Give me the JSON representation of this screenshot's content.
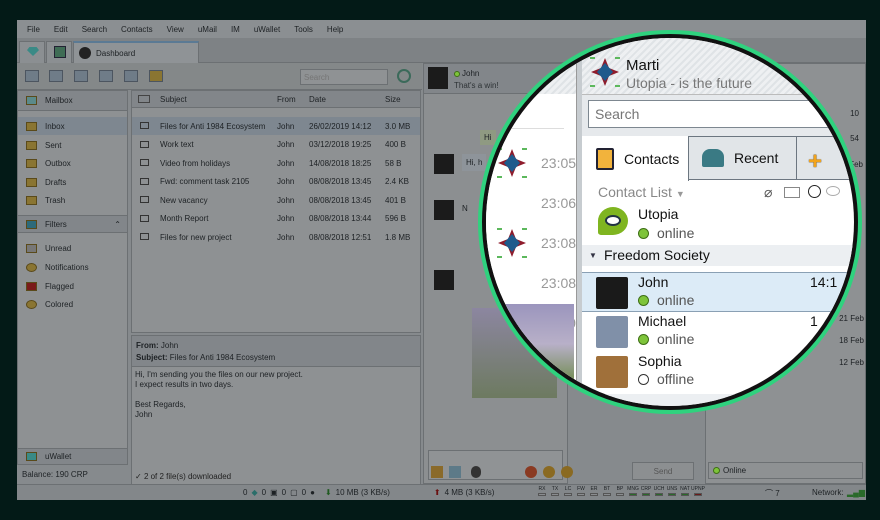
{
  "menu": [
    "File",
    "Edit",
    "Search",
    "Contacts",
    "View",
    "uMail",
    "IM",
    "uWallet",
    "Tools",
    "Help"
  ],
  "tabs": {
    "dashboard": "Dashboard"
  },
  "toolbar": {
    "search_placeholder": "Search"
  },
  "sidebar": {
    "mailbox": "Mailbox",
    "folders": [
      "Inbox",
      "Sent",
      "Outbox",
      "Drafts",
      "Trash"
    ],
    "filters_title": "Filters",
    "filters": [
      "Unread",
      "Notifications",
      "Flagged",
      "Colored"
    ],
    "wallet": "uWallet",
    "balance": "Balance: 190 CRP"
  },
  "mail": {
    "columns": [
      "Subject",
      "From",
      "Date",
      "Size"
    ],
    "rows": [
      {
        "subject": "Files for Anti 1984 Ecosystem",
        "from": "John",
        "date": "26/02/2019 14:12",
        "size": "3.0 MB"
      },
      {
        "subject": "Work text",
        "from": "John",
        "date": "03/12/2018 19:25",
        "size": "400 B"
      },
      {
        "subject": "Video from holidays",
        "from": "John",
        "date": "14/08/2018 18:25",
        "size": "58 B"
      },
      {
        "subject": "Fwd: comment task 2105",
        "from": "John",
        "date": "08/08/2018 13:45",
        "size": "2.4 KB"
      },
      {
        "subject": "New vacancy",
        "from": "John",
        "date": "08/08/2018 13:45",
        "size": "401 B"
      },
      {
        "subject": "Month Report",
        "from": "John",
        "date": "08/08/2018 13:44",
        "size": "596 B"
      },
      {
        "subject": "Files for new project",
        "from": "John",
        "date": "08/08/2018 12:51",
        "size": "1.8 MB"
      }
    ],
    "preview": {
      "from_label": "From:",
      "from": "John",
      "subject_label": "Subject:",
      "subject": "Files for Anti 1984 Ecosystem",
      "body": [
        "Hi, I'm sending you the files on our new project.",
        "I expect results in two days.",
        "",
        "Best Regards,",
        "John"
      ]
    },
    "download_status": "2 of 2 file(s) downloaded"
  },
  "chat": {
    "contact": "John",
    "last": "That's a win!",
    "bubbles": [
      "Hi",
      "Hi, h",
      "N"
    ],
    "times": [
      "23:05",
      "23:06",
      "23:08",
      "23:08",
      "23:09"
    ],
    "send": "Send"
  },
  "right": {
    "status": "Online",
    "dates": [
      "21 Feb",
      "18 Feb",
      "12 Feb"
    ],
    "times": [
      "10",
      "54"
    ],
    "feb": "Feb"
  },
  "statusbar": {
    "counts": [
      "0",
      "0",
      "0",
      "0"
    ],
    "down": "10 MB (3 KB/s)",
    "up": "4 MB (3 KB/s)",
    "indicators": [
      "RX",
      "TX",
      "LC",
      "FW",
      "ER",
      "BT",
      "BP",
      "MNG",
      "CRP",
      "UCH",
      "UNS",
      "NAT",
      "UPNP"
    ],
    "peers": "7",
    "network": "Network:"
  },
  "lens": {
    "user": "Marti",
    "motto": "Utopia - is the future",
    "search_placeholder": "Search",
    "tabs": [
      "Contacts",
      "Recent"
    ],
    "contact_list": "Contact List",
    "utopia": {
      "name": "Utopia",
      "status": "online"
    },
    "group": "Freedom Society",
    "contacts": [
      {
        "name": "John",
        "status": "online",
        "time": "14:1"
      },
      {
        "name": "Michael",
        "status": "online",
        "time": "1"
      },
      {
        "name": "Sophia",
        "status": "offline",
        "time": ""
      }
    ],
    "times": [
      "23:05",
      "23:06",
      "23:08",
      "23:08",
      "23:09"
    ],
    "colors": {
      "ring": "#2fd27e",
      "online": "#7ec43a",
      "selected": "#dcebf7"
    }
  }
}
